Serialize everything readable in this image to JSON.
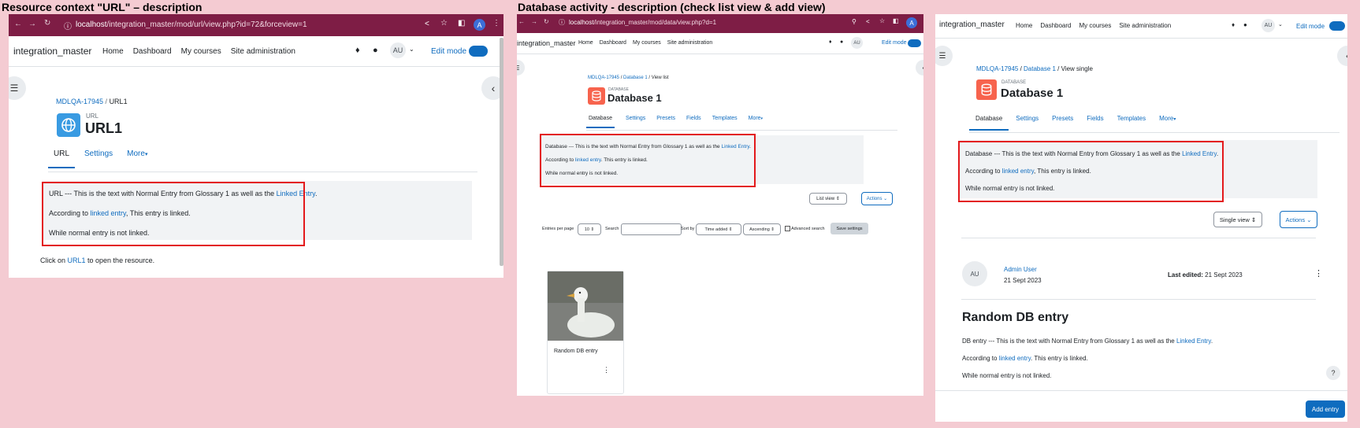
{
  "captions": {
    "left": "Resource context \"URL\" – description",
    "middle": "Database activity - description (check list view & add view)"
  },
  "colors": {
    "chrome": "#7e1d45",
    "link": "#0f6cbf",
    "highlight": "#e3191b"
  },
  "p1": {
    "url_host": "localhost",
    "url_path": "/integration_master/mod/url/view.php?id=72&forceview=1",
    "avatar_letter": "A",
    "brand": "integration_master",
    "nav": [
      "Home",
      "Dashboard",
      "My courses",
      "Site administration"
    ],
    "user_initials": "AU",
    "edit_mode": "Edit mode",
    "breadcrumb": [
      "MDLQA-17945",
      "URL1"
    ],
    "module_type": "URL",
    "title": "URL1",
    "tabs": [
      "URL",
      "Settings",
      "More"
    ],
    "desc_line1_prefix": "URL --- This is the text with Normal Entry from Glossary 1 as well as the ",
    "desc_line1_link": "Linked Entry",
    "desc_line2_prefix": "According to ",
    "desc_line2_link": "linked entry",
    "desc_line2_suffix": ", This entry is linked.",
    "desc_line3": "While normal entry is not linked.",
    "click_prefix": "Click on ",
    "click_link": "URL1",
    "click_suffix": " to open the resource."
  },
  "p2": {
    "url_host": "localhost",
    "url_path": "/integration_master/mod/data/view.php?d=1",
    "avatar_letter": "A",
    "brand": "integration_master",
    "nav": [
      "Home",
      "Dashboard",
      "My courses",
      "Site administration"
    ],
    "user_initials": "AU",
    "edit_mode": "Edit mode",
    "breadcrumb": [
      "MDLQA-17945",
      "Database 1",
      "View list"
    ],
    "module_type": "DATABASE",
    "title": "Database 1",
    "tabs": [
      "Database",
      "Settings",
      "Presets",
      "Fields",
      "Templates",
      "More"
    ],
    "desc_line1_prefix": "Database --- This is the text with Normal Entry from Glossary 1 as well as the ",
    "desc_line1_link": "Linked Entry",
    "desc_line2_prefix": "According to ",
    "desc_line2_link": "linked entry",
    "desc_line2_suffix": ". This entry is linked.",
    "desc_line3": "While normal entry is not linked.",
    "view_select": "List view",
    "actions": "Actions",
    "entries_per_page_label": "Entries per page",
    "entries_per_page": "10",
    "search_label": "Search",
    "sort_by_label": "Sort by",
    "sort_by": "Time added",
    "order": "Ascending",
    "advanced_search": "Advanced search",
    "save_settings": "Save settings",
    "entry_title": "Random DB entry"
  },
  "p3": {
    "brand": "integration_master",
    "nav": [
      "Home",
      "Dashboard",
      "My courses",
      "Site administration"
    ],
    "user_initials": "AU",
    "edit_mode": "Edit mode",
    "breadcrumb": [
      "MDLQA-17945",
      "Database 1",
      "View single"
    ],
    "module_type": "DATABASE",
    "title": "Database 1",
    "tabs": [
      "Database",
      "Settings",
      "Presets",
      "Fields",
      "Templates",
      "More"
    ],
    "desc_line1_prefix": "Database --- This is the text with Normal Entry from Glossary 1 as well as the ",
    "desc_line1_link": "Linked Entry",
    "desc_line2_prefix": "According to ",
    "desc_line2_link": "linked entry",
    "desc_line2_suffix": ", This entry is linked.",
    "desc_line3": "While normal entry is not linked.",
    "view_select": "Single view",
    "actions": "Actions",
    "author_initials": "AU",
    "author": "Admin User",
    "created": "21 Sept 2023",
    "last_edited_label": "Last edited:",
    "last_edited": "21 Sept 2023",
    "entry_title": "Random DB entry",
    "entry_line1_prefix": "DB entry --- This is the text with Normal Entry from Glossary 1 as well as the ",
    "entry_line1_link": "Linked Entry",
    "entry_line2_prefix": "According to ",
    "entry_line2_link": "linked entry",
    "entry_line2_suffix": ". This entry is linked.",
    "entry_line3": "While normal entry is not linked.",
    "help": "?",
    "add_entry": "Add entry"
  }
}
